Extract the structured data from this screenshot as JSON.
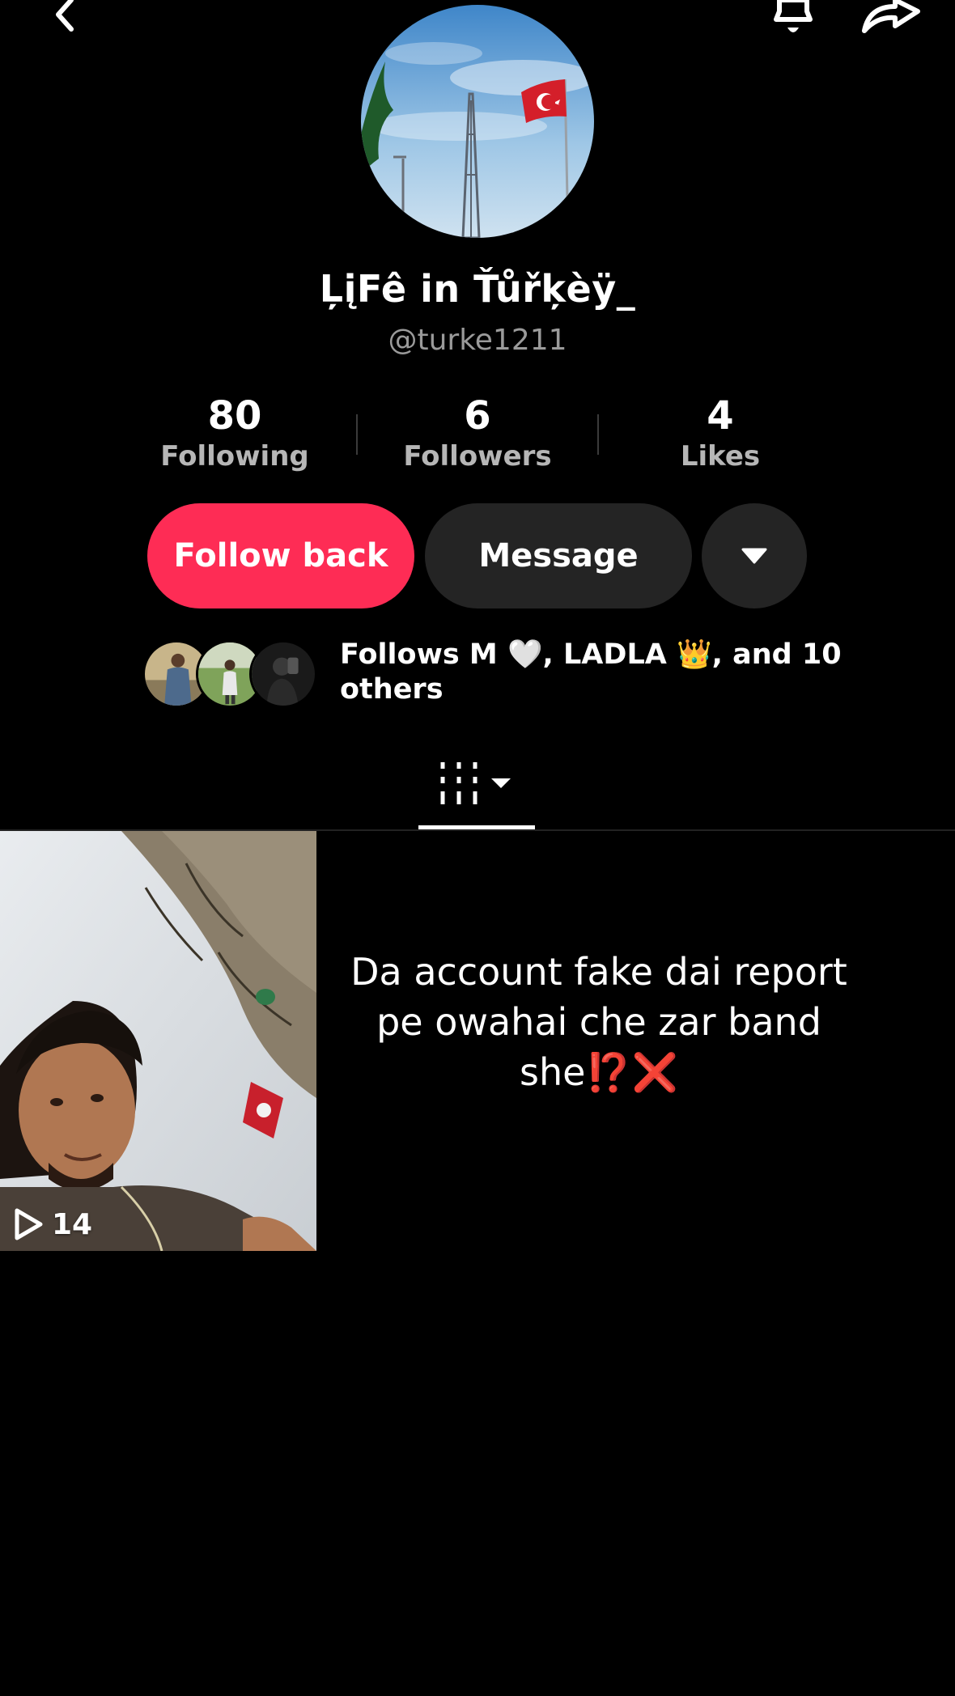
{
  "profile": {
    "display_name": "ĻįFê in Ťůřķèÿ_",
    "handle": "@turke1211"
  },
  "stats": [
    {
      "value": "80",
      "label": "Following"
    },
    {
      "value": "6",
      "label": "Followers"
    },
    {
      "value": "4",
      "label": "Likes"
    }
  ],
  "actions": {
    "follow_back_label": "Follow back",
    "message_label": "Message"
  },
  "follows": {
    "text": "Follows M 🤍, LADLA 👑, and 10 others"
  },
  "posts": [
    {
      "play_count": "14"
    }
  ],
  "caption": {
    "text": "Da account fake dai report pe owahai che zar band she",
    "emoji_1": "⁉️",
    "emoji_2": "❌"
  },
  "colors": {
    "background": "#000000",
    "follow_button": "#fe2c55",
    "secondary_button": "#242424",
    "muted_text": "#9a9a9a"
  },
  "icons": [
    "back-icon",
    "bell-icon",
    "share-icon",
    "dropdown-icon",
    "videos-grid-icon",
    "play-icon"
  ]
}
